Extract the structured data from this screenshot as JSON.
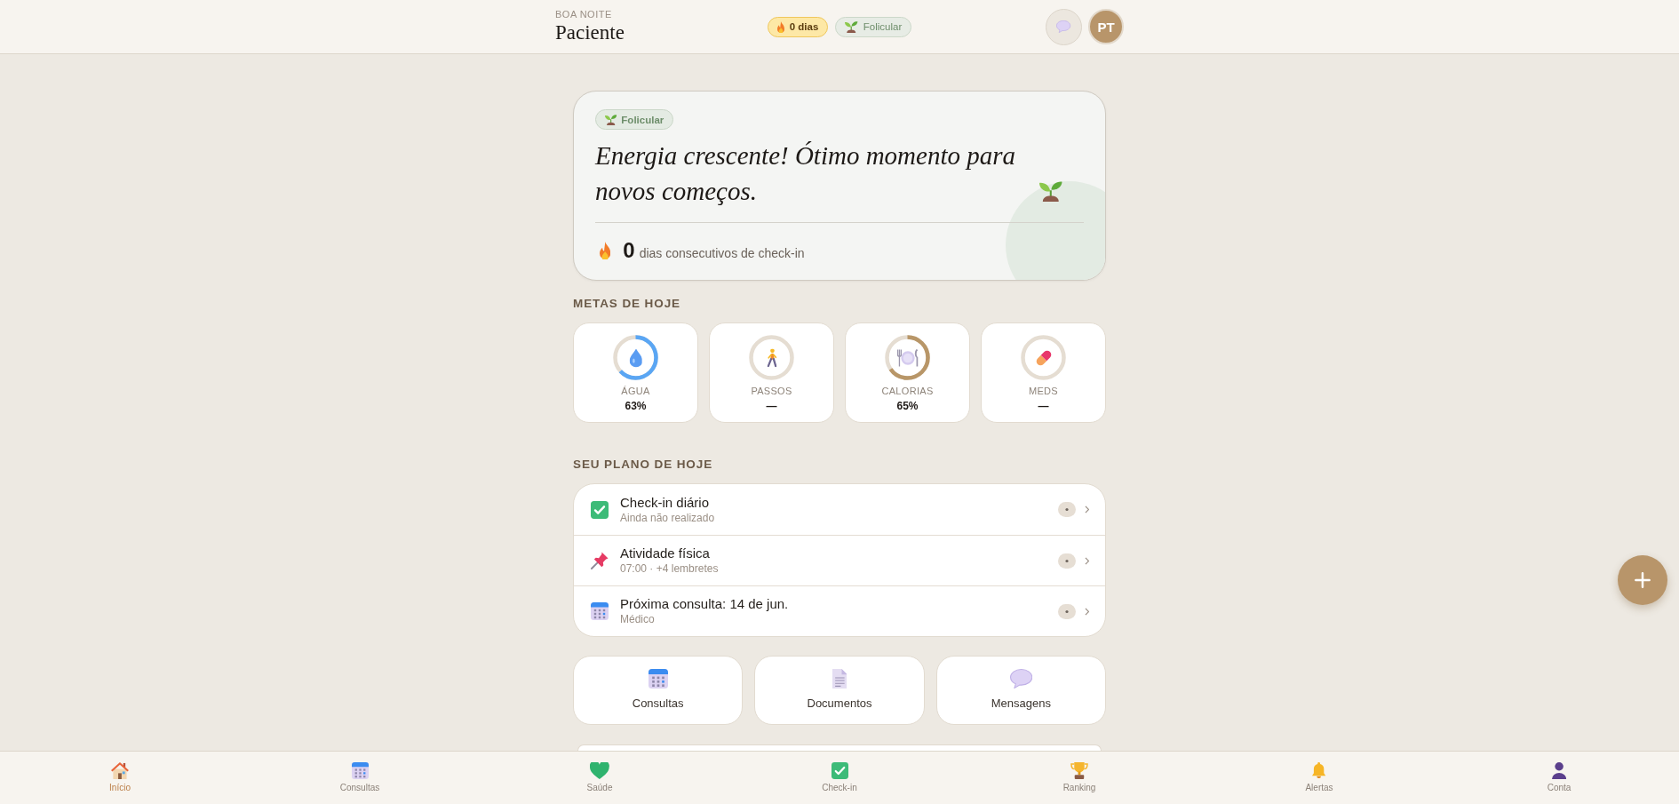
{
  "header": {
    "greeting": "BOA NOITE",
    "name": "Paciente",
    "badges": [
      {
        "kind": "streak",
        "label": "0 dias"
      },
      {
        "kind": "phase",
        "label": "Folicular"
      }
    ],
    "avatar_initials": "PT"
  },
  "hero": {
    "phase": "Folicular",
    "headline": "Energia crescente! Ótimo momento para novos começos.",
    "streak_count": "0",
    "streak_text": "dias consecutivos de check-in"
  },
  "goals": {
    "title": "METAS DE HOJE",
    "items": [
      {
        "kind": "water",
        "label": "ÁGUA",
        "value": "63%",
        "level": 0.63,
        "color": "#5aa6f4"
      },
      {
        "kind": "steps",
        "label": "PASSOS",
        "value": "—",
        "level": 0
      },
      {
        "kind": "calories",
        "label": "CALORIAS",
        "value": "65%",
        "level": 0.65,
        "color": "#b89668"
      },
      {
        "kind": "meds",
        "label": "MEDS",
        "value": "—",
        "level": 0
      }
    ]
  },
  "plan": {
    "title": "SEU PLANO DE HOJE",
    "items": [
      {
        "kind": "checkin",
        "title": "Check-in diário",
        "subtitle": "Ainda não realizado"
      },
      {
        "kind": "reminder",
        "title": "Atividade física",
        "subtitle": "07:00 · +4 lembretes"
      },
      {
        "kind": "appointment",
        "title": "Próxima consulta: 14 de jun.",
        "subtitle": "Médico"
      }
    ]
  },
  "shortcuts": [
    {
      "kind": "appointments",
      "label": "Consultas"
    },
    {
      "kind": "documents",
      "label": "Documentos"
    },
    {
      "kind": "messages",
      "label": "Mensagens"
    }
  ],
  "nav": {
    "items": [
      {
        "kind": "home",
        "label": "Início",
        "selected": true
      },
      {
        "kind": "appointments",
        "label": "Consultas",
        "selected": false
      },
      {
        "kind": "health",
        "label": "Saúde",
        "selected": false
      },
      {
        "kind": "checkin",
        "label": "Check-in",
        "selected": false
      },
      {
        "kind": "ranking",
        "label": "Ranking",
        "selected": false
      },
      {
        "kind": "alerts",
        "label": "Alertas",
        "selected": false
      },
      {
        "kind": "account",
        "label": "Conta",
        "selected": false
      }
    ]
  }
}
